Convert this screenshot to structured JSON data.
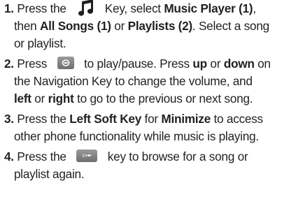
{
  "steps": [
    {
      "number": "1.",
      "lines": [
        [
          "Press the ",
          "",
          " Key, select ",
          "Music Player (1)",
          ","
        ],
        [
          "then ",
          "All Songs (1)",
          " or ",
          "Playlists (2)",
          ". Select a song"
        ],
        [
          "or playlist."
        ]
      ]
    },
    {
      "number": "2.",
      "line1_pre": "Press ",
      "line1_post": " to play/pause. Press ",
      "up": "up",
      "or1": " or ",
      "down": "down",
      "on": " on",
      "line2": "the Navigation Key to change the volume, and",
      "left": "left",
      "or2": " or ",
      "right": "right",
      "line3_post": " to go to the previous or next song."
    },
    {
      "number": "3.",
      "line1_pre": "Press the ",
      "lsk": "Left Soft Key",
      "for": " for ",
      "minimize": "Minimize",
      "line1_post": " to access",
      "line2": "other phone functionality while music is playing."
    },
    {
      "number": "4.",
      "line1_pre": "Press the ",
      "line1_post": " key to browse for a song or",
      "line2": "playlist again.",
      "clr_icon_text": "c•⬅"
    }
  ],
  "icons": {
    "music_key": "music-note-icon",
    "ok_key": "ok-key-icon",
    "clear_key": "clear-key-icon"
  }
}
